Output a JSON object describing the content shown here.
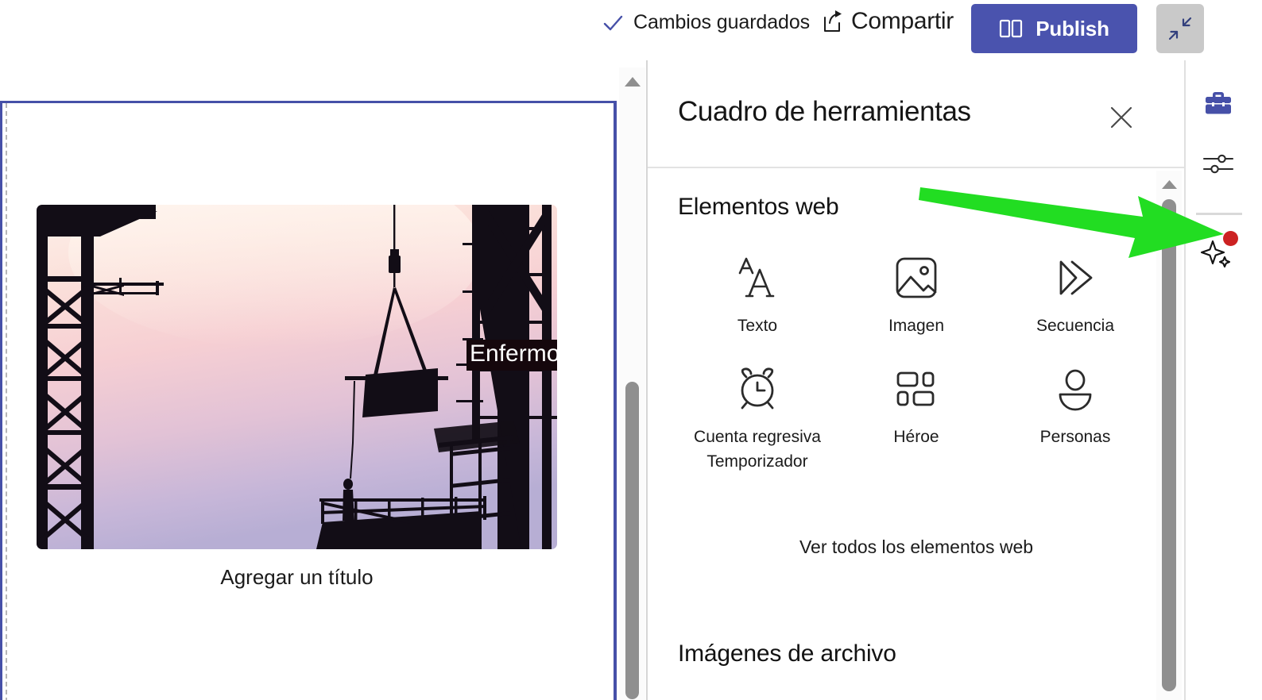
{
  "topbar": {
    "saved_status": "Cambios guardados",
    "saved_icon": "check-icon",
    "share_label": "Compartir",
    "share_icon": "share-icon",
    "publish_label": "Publish",
    "publish_icon": "book-icon",
    "publish_color": "#4a53ae",
    "collapse_icon": "collapse-diagonal-icon",
    "collapse_bg": "#c9c9c9"
  },
  "canvas": {
    "selection_border_color": "#4650a8",
    "image_alt_overlay_text": "Enfermo",
    "caption_placeholder": "Agregar un título",
    "image_description": "construction-site-silhouette-sunset"
  },
  "panel": {
    "title": "Cuadro de herramientas",
    "close_icon": "close-icon",
    "sections": {
      "web_elements_title": "Elementos web",
      "stock_images_title": "Imágenes de archivo"
    },
    "elements": [
      {
        "label": "Texto",
        "icon": "text-aa-icon"
      },
      {
        "label": "Imagen",
        "icon": "image-icon"
      },
      {
        "label": "Secuencia",
        "icon": "sequence-play-icon"
      },
      {
        "label": "Cuenta regresiva\nTemporizador",
        "icon": "alarm-clock-icon"
      },
      {
        "label": "Héroe",
        "icon": "hero-layout-icon"
      },
      {
        "label": "Personas",
        "icon": "person-icon"
      }
    ],
    "see_all_label": "Ver todos los elementos web"
  },
  "rail": {
    "items": [
      {
        "name": "toolbox",
        "icon": "toolbox-icon",
        "active": true,
        "color": "#4650a8"
      },
      {
        "name": "settings",
        "icon": "sliders-icon",
        "active": false,
        "color": "#2b2b2b"
      },
      {
        "name": "ai-assistant",
        "icon": "sparkle-icon",
        "active": false,
        "color": "#1b1b1b",
        "badge_color": "#cc2222"
      }
    ]
  },
  "annotation": {
    "arrow_color": "#22dd22",
    "points_to": "ai-assistant"
  }
}
